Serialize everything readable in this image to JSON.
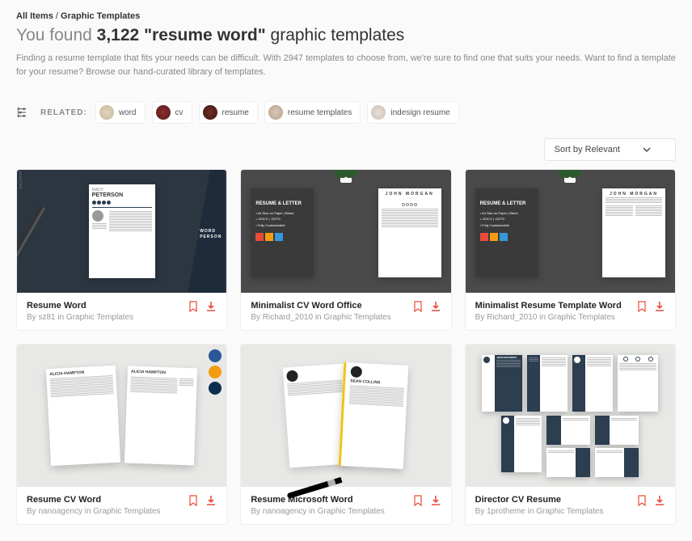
{
  "breadcrumb": {
    "root": "All Items",
    "current": "Graphic Templates"
  },
  "headline": {
    "prefix": "You found ",
    "count": "3,122",
    "term": " \"resume word\" ",
    "suffix": "graphic templates"
  },
  "description": "Finding a resume template that fits your needs can be difficult. With 2947 templates to choose from, we're sure to find one that suits your needs. Want to find a template for your resume? Browse our hand-curated library of templates.",
  "related": {
    "label": "RELATED:",
    "tags": [
      "word",
      "cv",
      "resume",
      "resume templates",
      "indesign resume"
    ]
  },
  "sort": {
    "label": "Sort by Relevant"
  },
  "cards": [
    {
      "title": "Resume Word",
      "byline": "By sz81 in Graphic Templates"
    },
    {
      "title": "Minimalist CV Word Office",
      "byline": "By Richard_2010 in Graphic Templates"
    },
    {
      "title": "Minimalist Resume Template Word",
      "byline": "By Richard_2010 in Graphic Templates"
    },
    {
      "title": "Resume CV Word",
      "byline": "By nanoagency in Graphic Templates"
    },
    {
      "title": "Resume Microsoft Word",
      "byline": "By nanoagency in Graphic Templates"
    },
    {
      "title": "Director CV Resume",
      "byline": "By 1protheme in Graphic Templates"
    }
  ],
  "thumbs": {
    "t1": {
      "name": "MADY",
      "surname": "PETERSON",
      "label": "WORD\nPERSON",
      "a4": "A4\nLETTER"
    },
    "t2": {
      "name": "JOHN MORGAN",
      "heading": "RESUME & LETTER",
      "bullets": "• A4 Size on Paper | Bleed\n• .DOCX | .DOTX\n• Fully Customizable"
    },
    "t3": {
      "name": "JOHN MORGAN",
      "heading": "RESUME & LETTER",
      "bullets": "• A4 Size on Paper | Bleed\n• .DOCX | .DOTX\n• Fully Customizable"
    },
    "t4": {
      "name1": "ALICIA HAMPTON",
      "name2": "ALICIA HAMPTON"
    },
    "t5": {
      "name": "SEAN COLLINS"
    },
    "t6": {
      "name": "JHON MACINERY"
    }
  }
}
